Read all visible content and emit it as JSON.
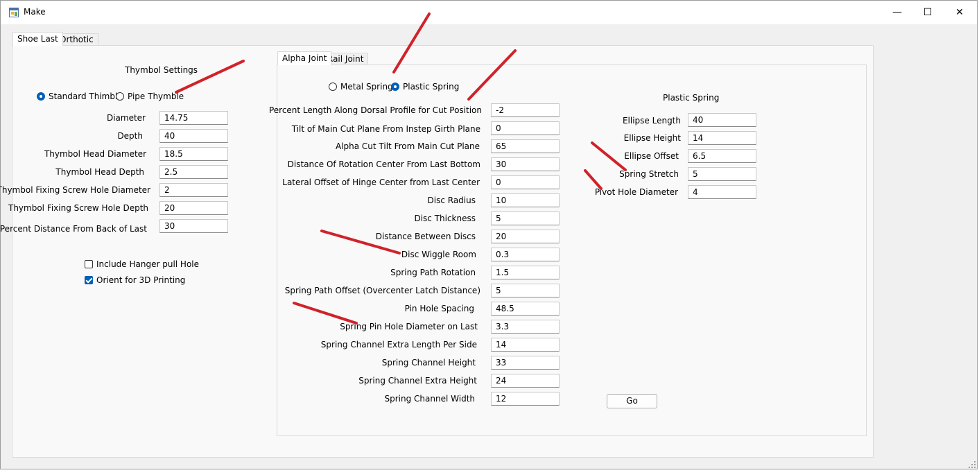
{
  "window": {
    "title": "Make",
    "controls": {
      "minimize": "—",
      "maximize": "☐",
      "close": "✕"
    }
  },
  "outer_tabs": [
    "Shoe Last",
    "Orthotic"
  ],
  "left": {
    "heading": "Thymbol Settings",
    "radio_standard": "Standard Thimble",
    "radio_pipe": "Pipe Thymble",
    "selected": "Standard Thimble",
    "fields": [
      {
        "label": "Diameter",
        "value": "14.75"
      },
      {
        "label": "Depth",
        "value": "40"
      },
      {
        "label": "Thymbol Head Diameter",
        "value": "18.5"
      },
      {
        "label": "Thymbol Head Depth",
        "value": "2.5"
      },
      {
        "label": "Thymbol Fixing Screw Hole Diameter",
        "value": "2"
      },
      {
        "label": "Thymbol Fixing Screw Hole Depth",
        "value": "20"
      },
      {
        "label": "Percent Distance From Back of Last",
        "value": "30"
      }
    ],
    "check_hanger": {
      "label": "Include Hanger pull Hole",
      "checked": false
    },
    "check_orient": {
      "label": "Orient for 3D Printing",
      "checked": true
    }
  },
  "inner_tabs": [
    "Alpha Joint",
    "Rail Joint"
  ],
  "alpha": {
    "radio_metal": "Metal Spring",
    "radio_plastic": "Plastic Spring",
    "selected": "Plastic Spring",
    "fields": [
      {
        "label": "Percent Length Along Dorsal Profile for Cut Position",
        "value": "-2"
      },
      {
        "label": "Tilt of Main Cut Plane From Instep Girth Plane",
        "value": "0"
      },
      {
        "label": "Alpha Cut Tilt From Main Cut Plane",
        "value": "65"
      },
      {
        "label": "Distance Of Rotation Center From Last Bottom",
        "value": "30"
      },
      {
        "label": "Lateral Offset of Hinge Center from Last Center",
        "value": "0"
      },
      {
        "label": "Disc Radius",
        "value": "10"
      },
      {
        "label": "Disc Thickness",
        "value": "5"
      },
      {
        "label": "Distance Between Discs",
        "value": "20"
      },
      {
        "label": "Disc Wiggle Room",
        "value": "0.3"
      },
      {
        "label": "Spring Path Rotation",
        "value": "1.5"
      },
      {
        "label": "Spring Path Offset (Overcenter Latch Distance)",
        "value": "5"
      },
      {
        "label": "Pin Hole Spacing",
        "value": "48.5"
      },
      {
        "label": "Spring Pin Hole Diameter on Last",
        "value": "3.3"
      },
      {
        "label": "Spring Channel Extra Length Per Side",
        "value": "14"
      },
      {
        "label": "Spring Channel Height",
        "value": "33"
      },
      {
        "label": "Spring Channel Extra Height",
        "value": "24"
      },
      {
        "label": "Spring Channel Width",
        "value": "12"
      }
    ],
    "plastic": {
      "heading": "Plastic Spring",
      "fields": [
        {
          "label": "Ellipse Length",
          "value": "40"
        },
        {
          "label": "Ellipse Height",
          "value": "14"
        },
        {
          "label": "Ellipse Offset",
          "value": "6.5"
        },
        {
          "label": "Spring Stretch",
          "value": "5"
        },
        {
          "label": "Pivot Hole Diameter",
          "value": "4"
        }
      ]
    },
    "go_label": "Go"
  },
  "colors": {
    "accent": "#005fb8",
    "annotation": "#d0222a"
  },
  "icons": [
    "app-icon",
    "minimize-icon",
    "maximize-icon",
    "close-icon",
    "resize-grip-icon"
  ]
}
